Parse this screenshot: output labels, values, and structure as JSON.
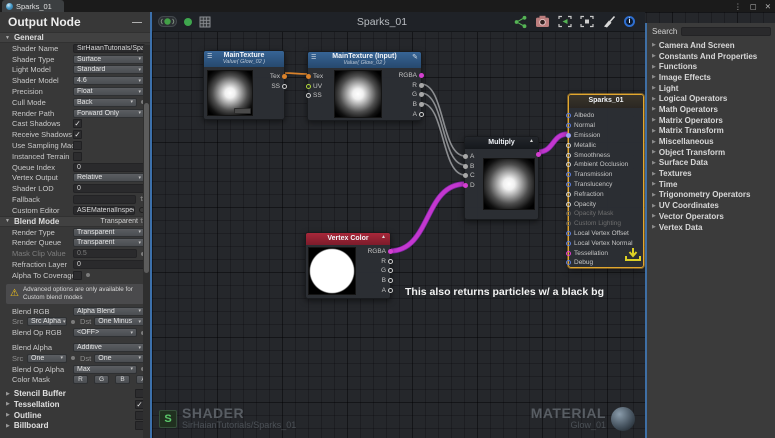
{
  "titlebar": {
    "tab": "Sparks_01"
  },
  "output_panel": {
    "title": "Output Node",
    "general_header": "General",
    "rows": [
      {
        "label": "Shader Name",
        "type": "text",
        "value": "SirHaianTutorials/Spark"
      },
      {
        "label": "Shader Type",
        "type": "dropdown",
        "value": "Surface"
      },
      {
        "label": "Light Model",
        "type": "dropdown",
        "value": "Standard"
      },
      {
        "label": "Shader Model",
        "type": "dropdown",
        "value": "4.6"
      },
      {
        "label": "Precision",
        "type": "dropdown",
        "value": "Float"
      },
      {
        "label": "Cull Mode",
        "type": "dropdown",
        "value": "Back",
        "extra": "dot"
      },
      {
        "label": "Render Path",
        "type": "dropdown",
        "value": "Forward Only"
      },
      {
        "label": "Cast Shadows",
        "type": "checkbox",
        "checked": true
      },
      {
        "label": "Receive Shadows",
        "type": "checkbox",
        "checked": true
      },
      {
        "label": "Use Sampling Mac",
        "type": "checkbox",
        "checked": false
      },
      {
        "label": "Instanced Terrain",
        "type": "checkbox",
        "checked": false
      },
      {
        "label": "Queue Index",
        "type": "text",
        "value": "0"
      },
      {
        "label": "Vertex Output",
        "type": "dropdown",
        "value": "Relative"
      },
      {
        "label": "Shader LOD",
        "type": "text",
        "value": "0"
      },
      {
        "label": "Fallback",
        "type": "text",
        "value": "",
        "extra": "updown"
      },
      {
        "label": "Custom Editor",
        "type": "text",
        "value": "ASEMaterialInspecto",
        "extra": "circle"
      }
    ],
    "blend_header": {
      "label": "Blend Mode",
      "value": "Transparent"
    },
    "blend_rows": [
      {
        "label": "Render Type",
        "type": "dropdown",
        "value": "Transparent"
      },
      {
        "label": "Render Queue",
        "type": "dropdown",
        "value": "Transparent"
      },
      {
        "label": "Mask Clip Value",
        "type": "text",
        "value": "0.5",
        "dim": true,
        "extra": "dot"
      },
      {
        "label": "Refraction Layer",
        "type": "text",
        "value": "0"
      },
      {
        "label": "Alpha To Coverage",
        "type": "checkbox",
        "checked": false,
        "extra": "dot"
      }
    ],
    "warning": "Advanced options are only available for Custom blend modes",
    "advanced_rows": [
      {
        "label": "Blend RGB",
        "type": "dropdown",
        "value": "Alpha Blend"
      },
      {
        "label": "Src",
        "type": "dualdrop",
        "value": "Src Alpha",
        "label2": "Dst",
        "value2": "One Minus"
      },
      {
        "label": "Blend Op RGB",
        "type": "dropdown",
        "value": "<OFF>",
        "extra": "dot"
      },
      {
        "label": "Blend Alpha",
        "type": "dropdown",
        "value": "Additive",
        "gap_before": true
      },
      {
        "label": "Src",
        "type": "dualdrop",
        "value": "One",
        "label2": "Dst",
        "value2": "One"
      },
      {
        "label": "Blend Op Alpha",
        "type": "dropdown",
        "value": "Max",
        "extra": "dot"
      },
      {
        "label": "Color Mask",
        "type": "mask",
        "buttons": [
          "R",
          "G",
          "B",
          "A"
        ],
        "extra": "dot"
      }
    ],
    "foldouts": [
      {
        "label": "Stencil Buffer",
        "checked": false
      },
      {
        "label": "Tessellation",
        "checked": true
      },
      {
        "label": "Outline",
        "checked": false
      },
      {
        "label": "Billboard",
        "checked": false
      }
    ]
  },
  "canvas": {
    "toolbar": {
      "title": "Sparks_01"
    },
    "note": "This also returns particles w/ a black bg",
    "footer": {
      "icon_letter": "S",
      "shader_label": "SHADER",
      "shader_name": "SirHaianTutorials/Sparks_01",
      "material_label": "MATERIAL",
      "material_name": "Glow_01"
    }
  },
  "palette": {
    "search_label": "Search",
    "categories": [
      "Camera And Screen",
      "Constants And Properties",
      "Functions",
      "Image Effects",
      "Light",
      "Logical Operators",
      "Math Operators",
      "Matrix Operators",
      "Matrix Transform",
      "Miscellaneous",
      "Object Transform",
      "Surface Data",
      "Textures",
      "Time",
      "Trigonometry Operators",
      "UV Coordinates",
      "Vector Operators",
      "Vertex Data"
    ]
  },
  "nodes": {
    "main_texture": {
      "title": "MainTexture",
      "subtitle": "Value( Glow_02 )",
      "outputs": [
        {
          "label": "Tex",
          "color": "#d9822b",
          "filled": true
        },
        {
          "label": "SS",
          "color": "#cfcfcf",
          "filled": false
        }
      ]
    },
    "main_texture_input": {
      "title": "MainTexture (Input)",
      "subtitle": "Value( Glow_02 )",
      "inputs": [
        {
          "label": "Tex",
          "color": "#d9822b",
          "filled": true
        },
        {
          "label": "UV",
          "color": "#b3d93c",
          "filled": false
        },
        {
          "label": "SS",
          "color": "#cfcfcf",
          "filled": false
        }
      ],
      "outputs": [
        {
          "label": "RGBA",
          "color": "#d43fd0",
          "filled": true
        },
        {
          "label": "R",
          "color": "#a8a8a8",
          "filled": true
        },
        {
          "label": "G",
          "color": "#a8a8a8",
          "filled": true
        },
        {
          "label": "B",
          "color": "#a8a8a8",
          "filled": true
        },
        {
          "label": "A",
          "color": "#cfcfcf",
          "filled": false
        }
      ]
    },
    "multiply": {
      "title": "Multiply",
      "inputs": [
        {
          "label": "A",
          "color": "#a8a8a8",
          "filled": true
        },
        {
          "label": "B",
          "color": "#a8a8a8",
          "filled": true
        },
        {
          "label": "C",
          "color": "#a8a8a8",
          "filled": true
        },
        {
          "label": "D",
          "color": "#d43fd0",
          "filled": true
        }
      ],
      "output_color": "#d43fd0"
    },
    "vertex_color": {
      "title": "Vertex Color",
      "outputs": [
        {
          "label": "RGBA",
          "color": "#d43fd0",
          "filled": true
        },
        {
          "label": "R",
          "color": "#cfcfcf",
          "filled": false
        },
        {
          "label": "G",
          "color": "#cfcfcf",
          "filled": false
        },
        {
          "label": "B",
          "color": "#cfcfcf",
          "filled": false
        },
        {
          "label": "A",
          "color": "#cfcfcf",
          "filled": false
        }
      ]
    },
    "master": {
      "title": "Sparks_01",
      "ports": [
        {
          "label": "Albedo",
          "color": "#5f7fd9",
          "filled": false
        },
        {
          "label": "Normal",
          "color": "#5f7fd9",
          "filled": false
        },
        {
          "label": "Emission",
          "color": "#9aa4ef",
          "filled": true
        },
        {
          "label": "Metallic",
          "color": "#cfcfcf",
          "filled": false
        },
        {
          "label": "Smoothness",
          "color": "#cfcfcf",
          "filled": false
        },
        {
          "label": "Ambient Occlusion",
          "color": "#cfcfcf",
          "filled": false
        },
        {
          "label": "Transmission",
          "color": "#5f7fd9",
          "filled": false
        },
        {
          "label": "Translucency",
          "color": "#5f7fd9",
          "filled": false
        },
        {
          "label": "Refraction",
          "color": "#cfcfcf",
          "filled": false
        },
        {
          "label": "Opacity",
          "color": "#cfcfcf",
          "filled": false
        },
        {
          "label": "Opacity Mask",
          "color": "#5c5c5c",
          "filled": false,
          "dim": true
        },
        {
          "label": "Custom Lighting",
          "color": "#5c5c5c",
          "filled": false,
          "dim": true
        },
        {
          "label": "Local Vertex Offset",
          "color": "#5f7fd9",
          "filled": false
        },
        {
          "label": "Local Vertex Normal",
          "color": "#5f7fd9",
          "filled": false
        },
        {
          "label": "Tessellation",
          "color": "#e040d0",
          "filled": false
        },
        {
          "label": "Debug",
          "color": "#5f7fd9",
          "filled": false
        }
      ]
    }
  },
  "connections": [
    {
      "from": "MainTexture.Tex",
      "to": "MainTextureInput.Tex",
      "color": "#d9822b",
      "width": 1.8
    },
    {
      "from": "MainTextureInput.R",
      "to": "Multiply.A",
      "color": "#8b8d90",
      "width": 1.6
    },
    {
      "from": "MainTextureInput.G",
      "to": "Multiply.B",
      "color": "#8b8d90",
      "width": 1.6
    },
    {
      "from": "MainTextureInput.B",
      "to": "Multiply.C",
      "color": "#8b8d90",
      "width": 1.6
    },
    {
      "from": "VertexColor.RGBA",
      "to": "Multiply.D",
      "color": "#c437cf",
      "width": 4
    },
    {
      "from": "Multiply.Out",
      "to": "Master.Emission",
      "color": "#c437cf",
      "width": 4
    }
  ]
}
